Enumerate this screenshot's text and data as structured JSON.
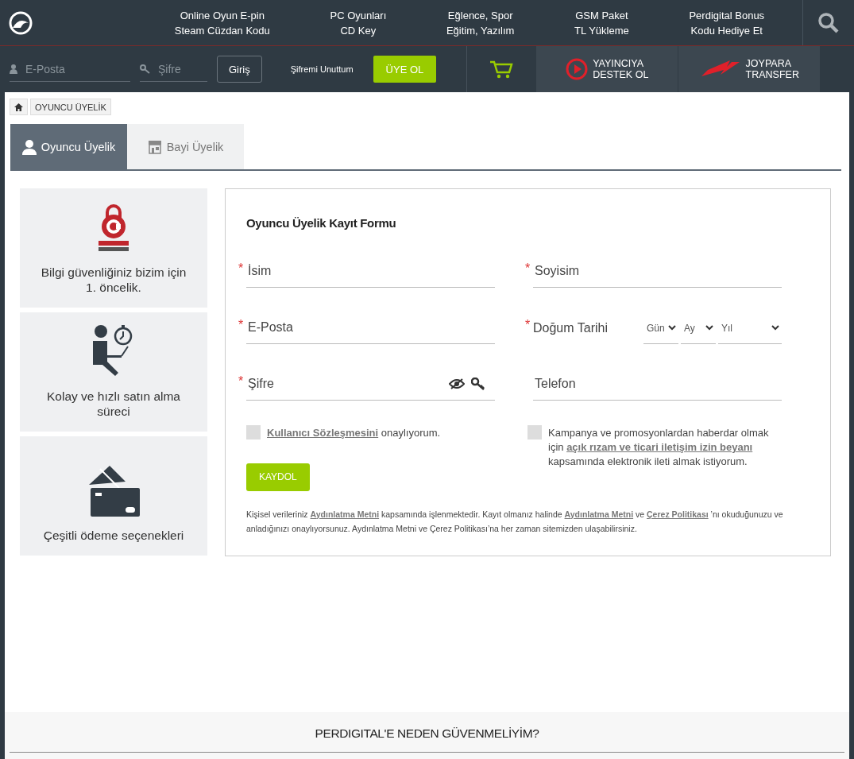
{
  "header": {
    "nav": [
      {
        "lines": [
          "Online Oyun E-pin",
          "Steam Cüzdan Kodu"
        ]
      },
      {
        "lines": [
          "PC Oyunları",
          "CD Key"
        ]
      },
      {
        "lines": [
          "Eğlence, Spor",
          "Eğitim, Yazılım"
        ]
      },
      {
        "lines": [
          "GSM Paket",
          "TL Yükleme"
        ]
      },
      {
        "lines": [
          "Perdigital Bonus",
          "Kodu Hediye Et"
        ]
      }
    ]
  },
  "login": {
    "email_placeholder": "E-Posta",
    "password_placeholder": "Şifre",
    "login_button": "Giriş",
    "forgot_link": "Şifremi Unuttum",
    "register_button": "ÜYE OL"
  },
  "promos": [
    {
      "kind": "stream",
      "lines": [
        "YAYINCIYA",
        "DESTEK OL"
      ]
    },
    {
      "kind": "transfer",
      "lines": [
        "JOYPARA",
        "TRANSFER"
      ]
    }
  ],
  "breadcrumb": [
    "OYUNCU ÜYELİK"
  ],
  "tabs": [
    {
      "label": "Oyuncu Üyelik",
      "kind": "player",
      "selected": true
    },
    {
      "label": "Bayi Üyelik",
      "kind": "dealer",
      "selected": false
    }
  ],
  "features": [
    {
      "kind": "ssl",
      "text": "Bilgi güvenliğiniz bizim için 1. öncelik."
    },
    {
      "kind": "fast",
      "text": "Kolay ve hızlı satın alma süreci"
    },
    {
      "kind": "payment",
      "text": "Çeşitli ödeme seçenekleri"
    }
  ],
  "form": {
    "title": "Oyuncu Üyelik Kayıt Formu",
    "fields": [
      {
        "kind": "text",
        "placeholder": "İsim",
        "marker": "*"
      },
      {
        "kind": "text",
        "placeholder": "Soyisim",
        "marker": "*"
      },
      {
        "kind": "text",
        "placeholder": "E-Posta",
        "marker": "*"
      },
      {
        "kind": "date",
        "label": "Doğum Tarihi",
        "marker": "*",
        "selects": [
          "Gün",
          "Ay",
          "Yıl"
        ]
      },
      {
        "kind": "password",
        "placeholder": "Şifre",
        "marker": "*"
      },
      {
        "kind": "text",
        "placeholder": "Telefon"
      }
    ],
    "consents": [
      {
        "checked": false,
        "parts": [
          {
            "kind": "link",
            "text": "Kullanıcı Sözleşmesini"
          },
          {
            "kind": "text",
            "text": " onaylıyorum."
          }
        ]
      },
      {
        "checked": false,
        "parts": [
          {
            "kind": "text",
            "text": "Kampanya ve promosyonlardan haberdar olmak için "
          },
          {
            "kind": "link",
            "text": "açık rızam ve ticari iletişim izin beyanı"
          },
          {
            "kind": "text",
            "text": " kapsamında elektronik ileti almak istiyorum."
          }
        ]
      }
    ],
    "submit": "KAYDOL",
    "notice": [
      {
        "kind": "text",
        "text": "Kişisel verileriniz "
      },
      {
        "kind": "link",
        "text": "Aydınlatma Metni"
      },
      {
        "kind": "text",
        "text": " kapsamında işlenmektedir. Kayıt olmanız halinde "
      },
      {
        "kind": "link",
        "text": "Aydınlatma Metni"
      },
      {
        "kind": "text",
        "text": " ve "
      },
      {
        "kind": "link",
        "text": "Çerez Politikası"
      },
      {
        "kind": "text",
        "text": " ’nı okuduğunuzu ve anladığınızı onaylıyorsunuz. Aydınlatma Metni ve Çerez Politikası’na her zaman sitemizden ulaşabilirsiniz."
      }
    ]
  },
  "trust_section": {
    "title": "PERDIGITAL'E NEDEN GÜVENMELİYİM?"
  }
}
